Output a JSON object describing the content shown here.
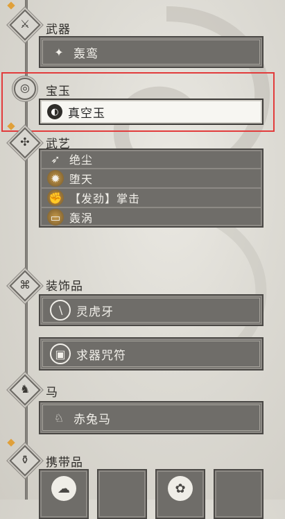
{
  "sections": {
    "weapon": {
      "label": "武器",
      "icon": "sword-icon",
      "item": {
        "name": "轰鸾",
        "icon": "weapon-emblem-icon"
      }
    },
    "jade": {
      "label": "宝玉",
      "icon": "jade-swirl-icon",
      "item": {
        "name": "真空玉",
        "icon": "vacuum-jade-icon"
      }
    },
    "arts": {
      "label": "武艺",
      "icon": "martial-arts-icon",
      "items": [
        {
          "name": "绝尘",
          "icon": "dash-icon"
        },
        {
          "name": "堕天",
          "icon": "flame-icon"
        },
        {
          "name": "【发劲】掌击",
          "icon": "palm-strike-icon"
        },
        {
          "name": "轰涡",
          "icon": "vortex-icon"
        }
      ]
    },
    "accessories": {
      "label": "装饰品",
      "icon": "accessory-icon",
      "items": [
        {
          "name": "灵虎牙",
          "icon": "tiger-fang-icon"
        },
        {
          "name": "求器咒符",
          "icon": "talisman-icon"
        }
      ]
    },
    "horse": {
      "label": "马",
      "icon": "horse-icon",
      "item": {
        "name": "赤兔马",
        "icon": "red-hare-icon"
      }
    },
    "carry": {
      "label": "携带品",
      "icon": "pouch-icon",
      "slots": [
        "bun-icon",
        "empty-slot",
        "flower-item-icon",
        "empty-slot"
      ]
    }
  },
  "colors": {
    "accent": "#e0a03a",
    "highlight": "#e23b3b",
    "slot": "#6f6d69"
  }
}
